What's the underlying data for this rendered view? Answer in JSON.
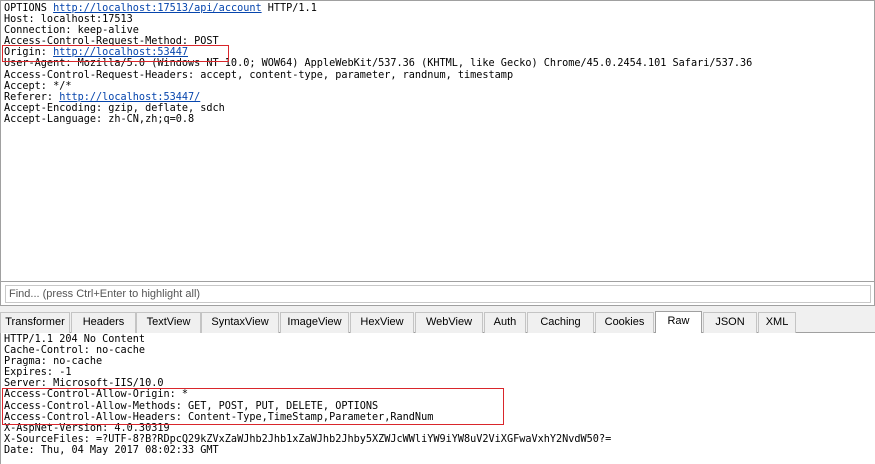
{
  "request": {
    "lines": [
      {
        "parts": [
          {
            "t": "OPTIONS "
          },
          {
            "t": "http://localhost:17513/api/account",
            "link": true
          },
          {
            "t": " HTTP/1.1"
          }
        ]
      },
      {
        "parts": [
          {
            "t": "Host: localhost:17513"
          }
        ]
      },
      {
        "parts": [
          {
            "t": "Connection: keep-alive"
          }
        ]
      },
      {
        "parts": [
          {
            "t": "Access-Control-Request-Method: POST"
          }
        ]
      },
      {
        "parts": [
          {
            "t": "Origin: "
          },
          {
            "t": "http://localhost:53447",
            "link": true
          }
        ]
      },
      {
        "parts": [
          {
            "t": "User-Agent: Mozilla/5.0 (Windows NT 10.0; WOW64) AppleWebKit/537.36 (KHTML, like Gecko) Chrome/45.0.2454.101 Safari/537.36"
          }
        ]
      },
      {
        "parts": [
          {
            "t": "Access-Control-Request-Headers: accept, content-type, parameter, randnum, timestamp"
          }
        ]
      },
      {
        "parts": [
          {
            "t": "Accept: */*"
          }
        ]
      },
      {
        "parts": [
          {
            "t": "Referer: "
          },
          {
            "t": "http://localhost:53447/",
            "link": true
          }
        ]
      },
      {
        "parts": [
          {
            "t": "Accept-Encoding: gzip, deflate, sdch"
          }
        ]
      },
      {
        "parts": [
          {
            "t": "Accept-Language: zh-CN,zh;q=0.8"
          }
        ]
      }
    ]
  },
  "find": {
    "placeholder": "Find... (press Ctrl+Enter to highlight all)"
  },
  "tabs": [
    {
      "label": "Transformer",
      "active": false
    },
    {
      "label": "Headers",
      "active": false
    },
    {
      "label": "TextView",
      "active": false
    },
    {
      "label": "SyntaxView",
      "active": false
    },
    {
      "label": "ImageView",
      "active": false
    },
    {
      "label": "HexView",
      "active": false
    },
    {
      "label": "WebView",
      "active": false
    },
    {
      "label": "Auth",
      "active": false
    },
    {
      "label": "Caching",
      "active": false
    },
    {
      "label": "Cookies",
      "active": false
    },
    {
      "label": "Raw",
      "active": true
    },
    {
      "label": "JSON",
      "active": false
    },
    {
      "label": "XML",
      "active": false
    }
  ],
  "response": {
    "lines": [
      {
        "parts": [
          {
            "t": "HTTP/1.1 204 No Content"
          }
        ]
      },
      {
        "parts": [
          {
            "t": "Cache-Control: no-cache"
          }
        ]
      },
      {
        "parts": [
          {
            "t": "Pragma: no-cache"
          }
        ]
      },
      {
        "parts": [
          {
            "t": "Expires: -1"
          }
        ]
      },
      {
        "parts": [
          {
            "t": "Server: Microsoft-IIS/10.0"
          }
        ]
      },
      {
        "parts": [
          {
            "t": "Access-Control-Allow-Origin: *"
          }
        ]
      },
      {
        "parts": [
          {
            "t": "Access-Control-Allow-Methods: GET, POST, PUT, DELETE, OPTIONS"
          }
        ]
      },
      {
        "parts": [
          {
            "t": "Access-Control-Allow-Headers: Content-Type,TimeStamp,Parameter,RandNum"
          }
        ]
      },
      {
        "parts": [
          {
            "t": "X-AspNet-Version: 4.0.30319"
          }
        ]
      },
      {
        "parts": [
          {
            "t": "X-SourceFiles: =?UTF-8?B?RDpcQ29kZVxZaWJhb2Jhb1xZaWJhb2Jhby5XZWJcWWliYW9iYW8uV2ViXGFwaVxhY2NvdW50?="
          }
        ]
      },
      {
        "parts": [
          {
            "t": "Date: Thu, 04 May 2017 08:02:33 GMT"
          }
        ]
      }
    ]
  },
  "colors": {
    "highlight_border": "#d9262b",
    "link": "#0645ad"
  }
}
